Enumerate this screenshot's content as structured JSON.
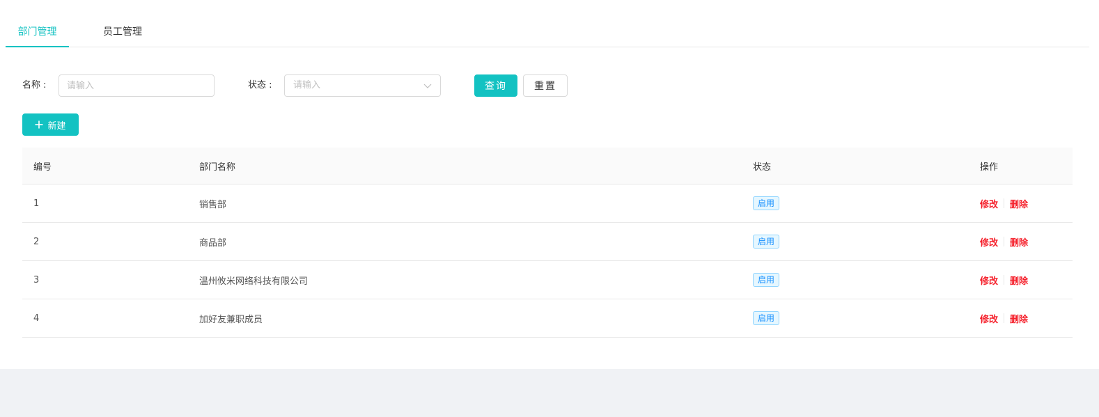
{
  "tabs": [
    {
      "label": "部门管理",
      "active": true
    },
    {
      "label": "员工管理",
      "active": false
    }
  ],
  "search": {
    "name_label": "名称 :",
    "name_placeholder": "请输入",
    "status_label": "状态 :",
    "status_placeholder": "请输入",
    "query_label": "查询",
    "reset_label": "重置"
  },
  "toolbar": {
    "new_label": "新建"
  },
  "table": {
    "columns": [
      "编号",
      "部门名称",
      "状态",
      "操作"
    ],
    "rows": [
      {
        "id": "1",
        "name": "销售部",
        "status": "启用",
        "edit": "修改",
        "delete": "删除"
      },
      {
        "id": "2",
        "name": "商品部",
        "status": "启用",
        "edit": "修改",
        "delete": "删除"
      },
      {
        "id": "3",
        "name": "温州攸米网络科技有限公司",
        "status": "启用",
        "edit": "修改",
        "delete": "删除"
      },
      {
        "id": "4",
        "name": "加好友兼职成员",
        "status": "启用",
        "edit": "修改",
        "delete": "删除"
      }
    ]
  },
  "colors": {
    "accent": "#13c2c2",
    "tag_text": "#1890ff",
    "tag_border": "#91d5ff",
    "tag_bg": "#e6f7ff",
    "danger": "#f5222d"
  },
  "icons": {
    "select_arrow": "chevron-down-icon",
    "new_button": "plus-icon"
  }
}
